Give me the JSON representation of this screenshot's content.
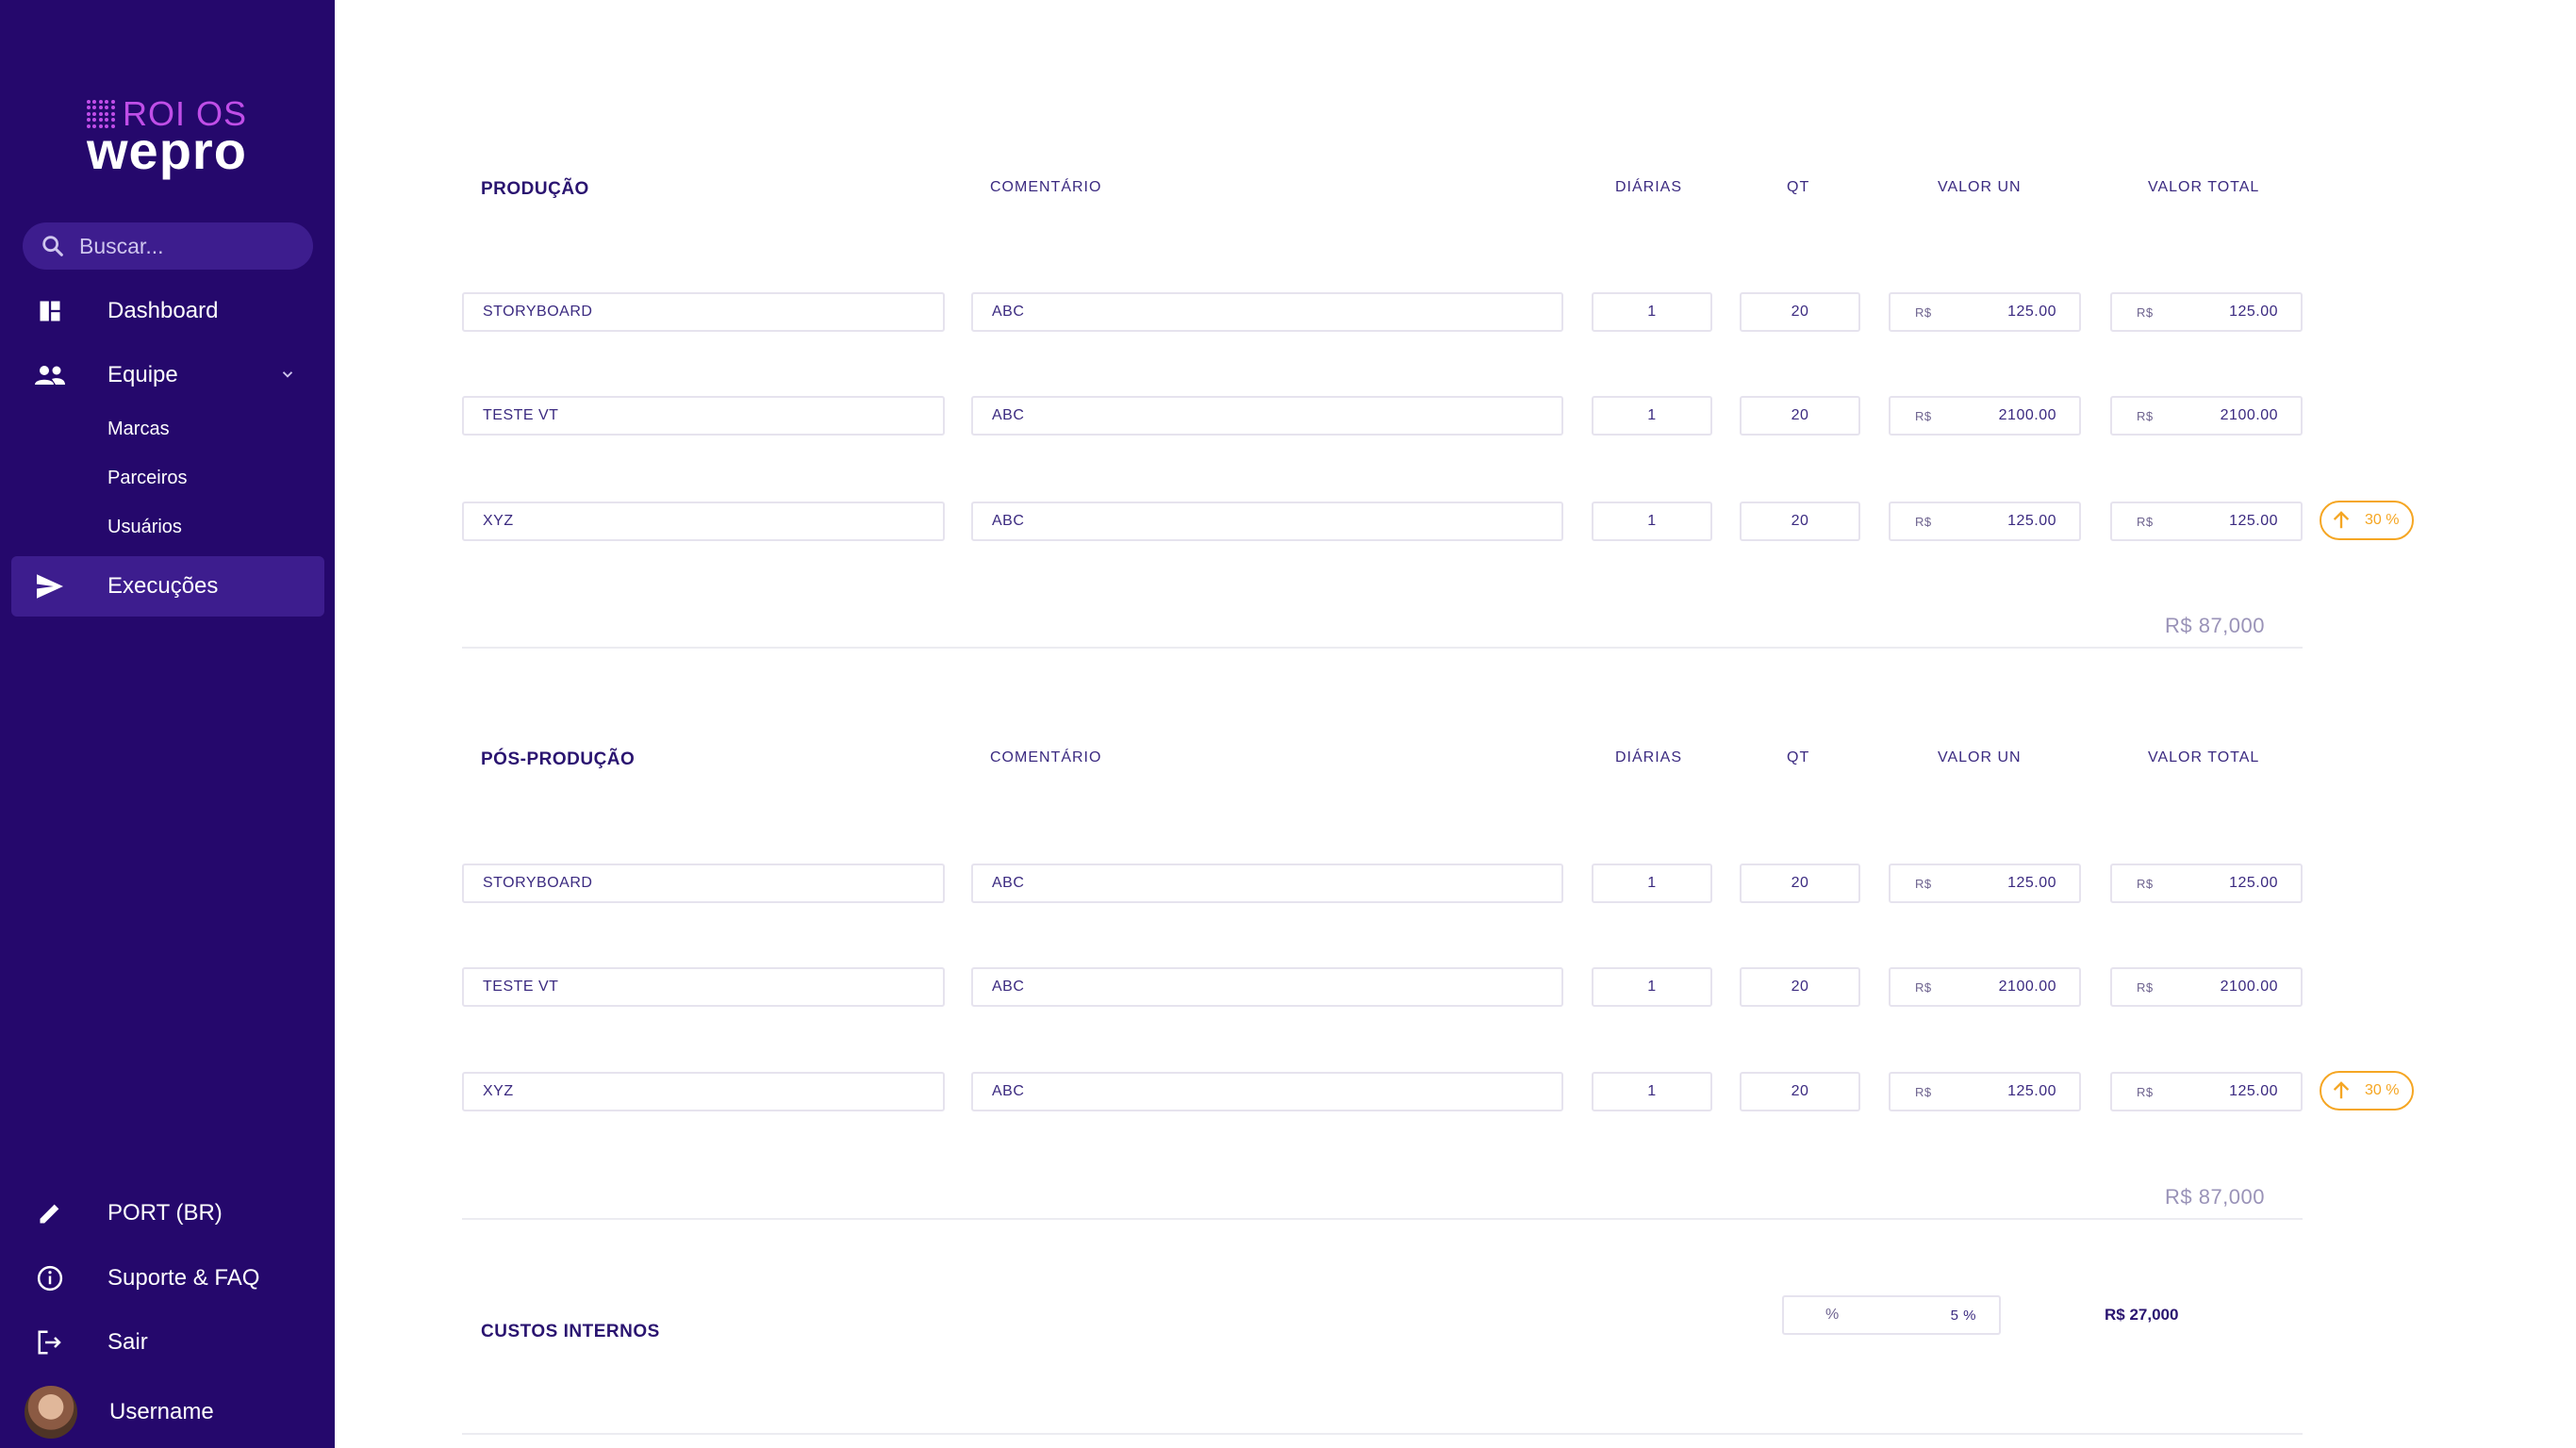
{
  "brand": {
    "top": "ROI OS",
    "bottom": "wepro"
  },
  "search": {
    "placeholder": "Buscar..."
  },
  "nav": {
    "dashboard": "Dashboard",
    "equipe": "Equipe",
    "sub": [
      "Marcas",
      "Parceiros",
      "Usuários"
    ],
    "execucoes": "Execuções",
    "language": "PORT (BR)",
    "support": "Suporte & FAQ",
    "logout": "Sair",
    "username": "Username"
  },
  "columns": {
    "comment": "COMENTÁRIO",
    "days": "DIÁRIAS",
    "qt": "QT",
    "unit": "VALOR UN",
    "total": "VALOR TOTAL"
  },
  "currency": "R$",
  "sections": [
    {
      "title": "PRODUÇÃO",
      "rows": [
        {
          "name": "STORYBOARD",
          "comment": "ABC",
          "days": "1",
          "qt": "20",
          "unit": "125.00",
          "total": "125.00"
        },
        {
          "name": "TESTE VT",
          "comment": "ABC",
          "days": "1",
          "qt": "20",
          "unit": "2100.00",
          "total": "2100.00"
        },
        {
          "name": "XYZ",
          "comment": "ABC",
          "days": "1",
          "qt": "20",
          "unit": "125.00",
          "total": "125.00",
          "badge": "30 %"
        }
      ],
      "sum": "R$ 87,000"
    },
    {
      "title": "PÓS-PRODUÇÃO",
      "rows": [
        {
          "name": "STORYBOARD",
          "comment": "ABC",
          "days": "1",
          "qt": "20",
          "unit": "125.00",
          "total": "125.00"
        },
        {
          "name": "TESTE VT",
          "comment": "ABC",
          "days": "1",
          "qt": "20",
          "unit": "2100.00",
          "total": "2100.00"
        },
        {
          "name": "XYZ",
          "comment": "ABC",
          "days": "1",
          "qt": "20",
          "unit": "125.00",
          "total": "125.00",
          "badge": "30 %"
        }
      ],
      "sum": "R$ 87,000"
    }
  ],
  "internal": {
    "title": "CUSTOS INTERNOS",
    "pct_symbol": "%",
    "pct_value": "5 %",
    "amount": "R$ 27,000"
  },
  "colors": {
    "sidebar": "#25086c",
    "accent": "#c04ee8",
    "badge": "#f5a623"
  }
}
